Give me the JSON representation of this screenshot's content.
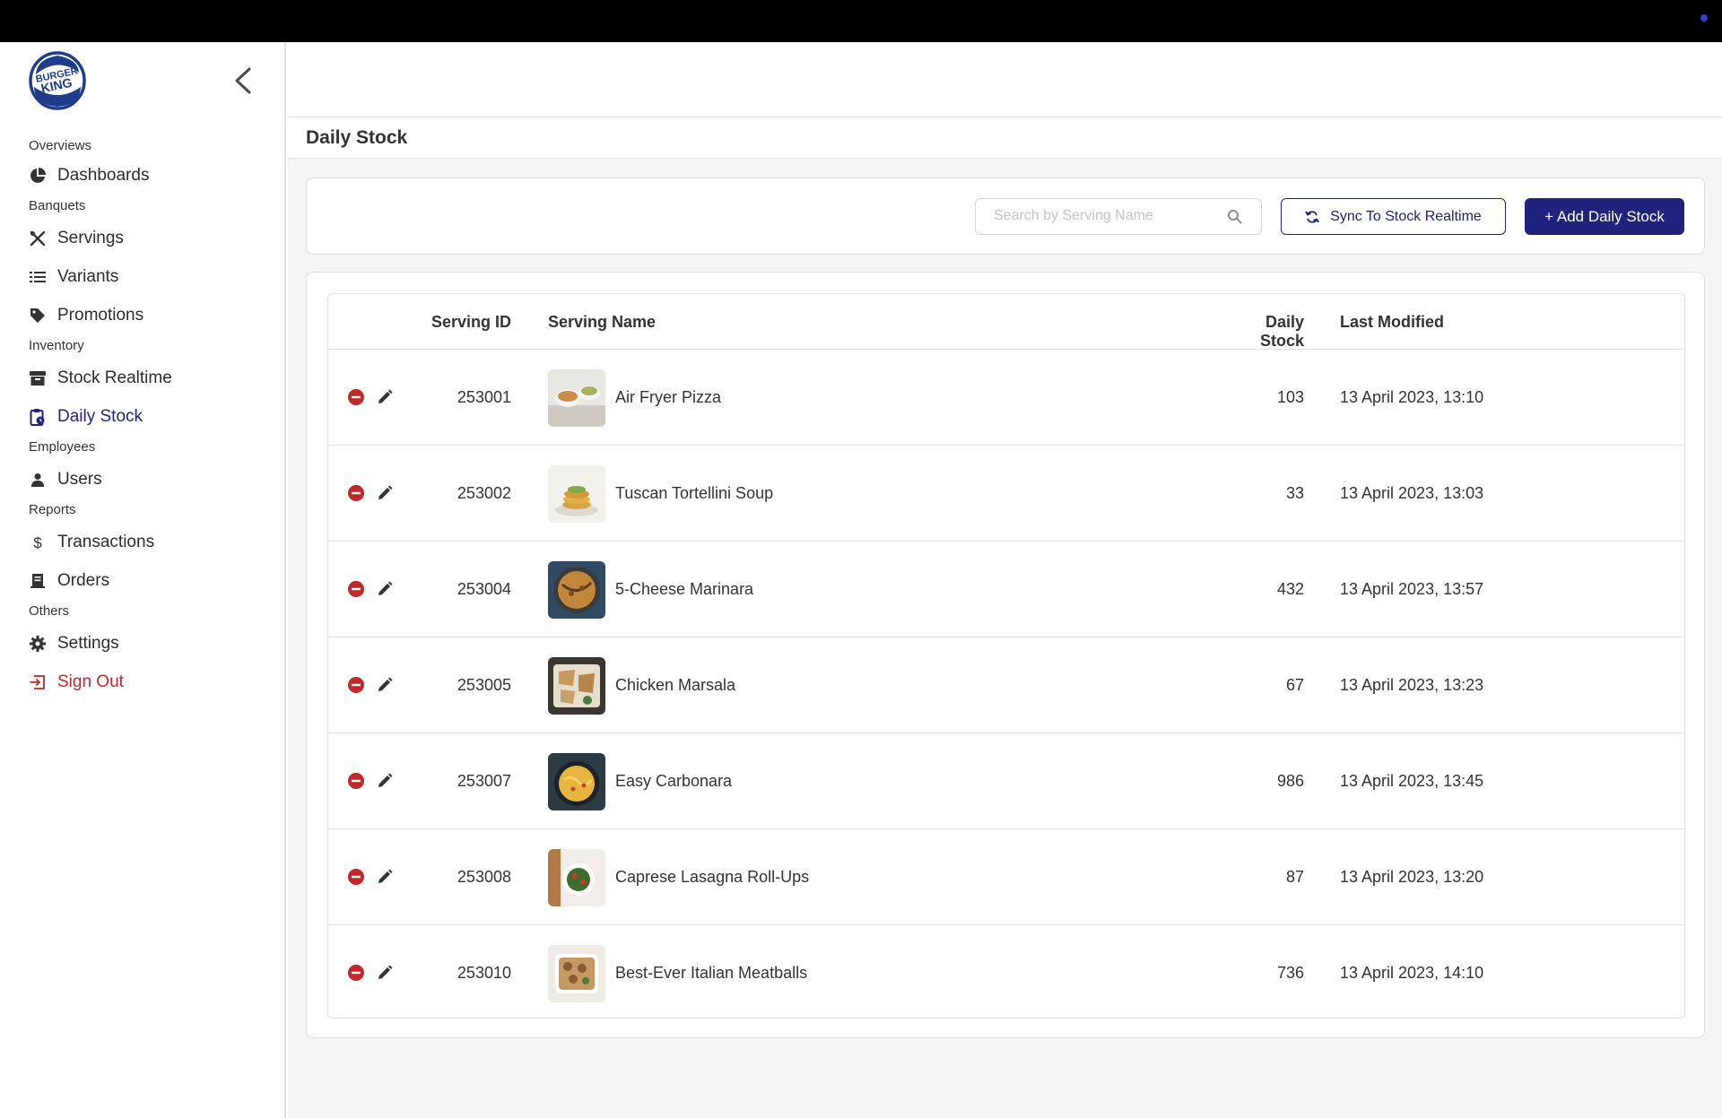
{
  "sidebar": {
    "logo_text_top": "BURGER",
    "logo_text_bottom": "KING",
    "sections": {
      "overviews": "Overviews",
      "banquets": "Banquets",
      "inventory": "Inventory",
      "employees": "Employees",
      "reports": "Reports",
      "others": "Others"
    },
    "items": {
      "dashboards": "Dashboards",
      "servings": "Servings",
      "variants": "Variants",
      "promotions": "Promotions",
      "stock_realtime": "Stock Realtime",
      "daily_stock": "Daily Stock",
      "users": "Users",
      "transactions": "Transactions",
      "orders": "Orders",
      "settings": "Settings",
      "sign_out": "Sign Out"
    }
  },
  "page": {
    "title": "Daily Stock"
  },
  "toolbar": {
    "search_placeholder": "Search by Serving Name",
    "sync_label": "Sync To Stock Realtime",
    "add_label": "+ Add Daily Stock"
  },
  "table": {
    "headers": {
      "serving_id": "Serving ID",
      "serving_name": "Serving Name",
      "daily_stock": "Daily Stock",
      "last_modified": "Last Modified"
    },
    "rows": [
      {
        "id": "253001",
        "name": "Air Fryer Pizza",
        "stock": "103",
        "modified": "13 April 2023, 13:10"
      },
      {
        "id": "253002",
        "name": "Tuscan Tortellini Soup",
        "stock": "33",
        "modified": "13 April 2023, 13:03"
      },
      {
        "id": "253004",
        "name": "5-Cheese Marinara",
        "stock": "432",
        "modified": "13 April 2023, 13:57"
      },
      {
        "id": "253005",
        "name": "Chicken Marsala",
        "stock": "67",
        "modified": "13 April 2023, 13:23"
      },
      {
        "id": "253007",
        "name": "Easy Carbonara",
        "stock": "986",
        "modified": "13 April 2023, 13:45"
      },
      {
        "id": "253008",
        "name": "Caprese Lasagna Roll-Ups",
        "stock": "87",
        "modified": "13 April 2023, 13:20"
      },
      {
        "id": "253010",
        "name": "Best-Ever Italian Meatballs",
        "stock": "736",
        "modified": "13 April 2023, 14:10"
      }
    ]
  },
  "colors": {
    "accent": "#1f237d",
    "danger": "#c0282a"
  }
}
